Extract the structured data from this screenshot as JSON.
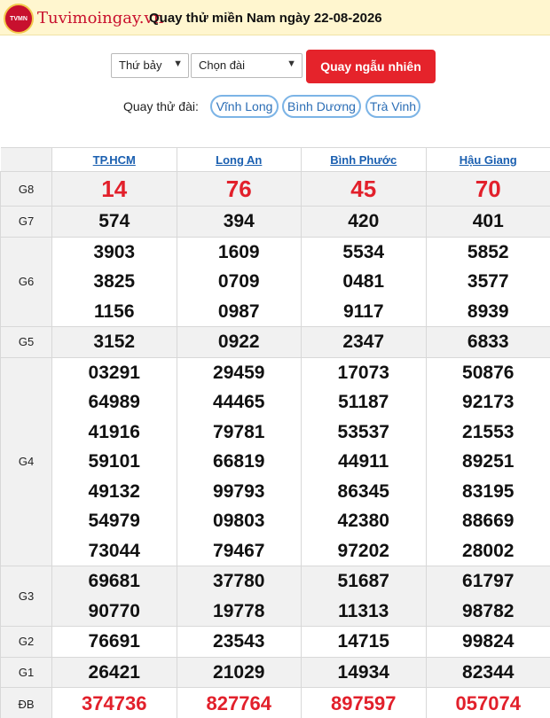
{
  "header": {
    "logo_badge": "TVMN",
    "logo_text": "Tuvimoingay.vn",
    "title": "Quay thử miền Nam ngày 22-08-2026"
  },
  "controls": {
    "day_select": "Thứ bảy",
    "station_select": "Chọn đài",
    "random_button": "Quay ngẫu nhiên"
  },
  "stations": {
    "label": "Quay thử đài:",
    "chips": [
      "Vĩnh Long",
      "Bình Dương",
      "Trà Vinh"
    ]
  },
  "colors": {
    "accent_red": "#e5232b",
    "link_blue": "#1a5fb0",
    "chip_border": "#7cb4e6"
  },
  "table": {
    "provinces": [
      "TP.HCM",
      "Long An",
      "Bình Phước",
      "Hậu Giang"
    ],
    "rows": [
      {
        "label": "G8",
        "values": [
          [
            "14"
          ],
          [
            "76"
          ],
          [
            "45"
          ],
          [
            "70"
          ]
        ]
      },
      {
        "label": "G7",
        "values": [
          [
            "574"
          ],
          [
            "394"
          ],
          [
            "420"
          ],
          [
            "401"
          ]
        ]
      },
      {
        "label": "G6",
        "values": [
          [
            "3903",
            "3825",
            "1156"
          ],
          [
            "1609",
            "0709",
            "0987"
          ],
          [
            "5534",
            "0481",
            "9117"
          ],
          [
            "5852",
            "3577",
            "8939"
          ]
        ]
      },
      {
        "label": "G5",
        "values": [
          [
            "3152"
          ],
          [
            "0922"
          ],
          [
            "2347"
          ],
          [
            "6833"
          ]
        ]
      },
      {
        "label": "G4",
        "values": [
          [
            "03291",
            "64989",
            "41916",
            "59101",
            "49132",
            "54979",
            "73044"
          ],
          [
            "29459",
            "44465",
            "79781",
            "66819",
            "99793",
            "09803",
            "79467"
          ],
          [
            "17073",
            "51187",
            "53537",
            "44911",
            "86345",
            "42380",
            "97202"
          ],
          [
            "50876",
            "92173",
            "21553",
            "89251",
            "83195",
            "88669",
            "28002"
          ]
        ]
      },
      {
        "label": "G3",
        "values": [
          [
            "69681",
            "90770"
          ],
          [
            "37780",
            "19778"
          ],
          [
            "51687",
            "11313"
          ],
          [
            "61797",
            "98782"
          ]
        ]
      },
      {
        "label": "G2",
        "values": [
          [
            "76691"
          ],
          [
            "23543"
          ],
          [
            "14715"
          ],
          [
            "99824"
          ]
        ]
      },
      {
        "label": "G1",
        "values": [
          [
            "26421"
          ],
          [
            "21029"
          ],
          [
            "14934"
          ],
          [
            "82344"
          ]
        ]
      },
      {
        "label": "ĐB",
        "values": [
          [
            "374736"
          ],
          [
            "827764"
          ],
          [
            "897597"
          ],
          [
            "057074"
          ]
        ]
      }
    ]
  }
}
